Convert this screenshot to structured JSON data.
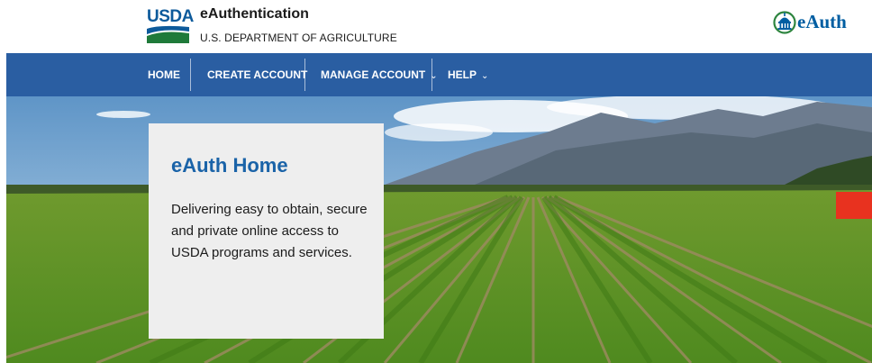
{
  "header": {
    "logo_text": "USDA",
    "title": "eAuthentication",
    "subtitle": "U.S. DEPARTMENT OF AGRICULTURE",
    "brand_text": "eAuth"
  },
  "nav": {
    "items": [
      {
        "label": "HOME"
      },
      {
        "label": "CREATE ACCOUNT"
      },
      {
        "label": "MANAGE ACCOUNT"
      },
      {
        "label": "HELP"
      }
    ]
  },
  "hero": {
    "title": "eAuth Home",
    "description": "Delivering easy to obtain, secure and private online access to USDA programs and services."
  },
  "colors": {
    "nav_bg": "#2a5ea2",
    "brand_blue": "#005ea2",
    "title_blue": "#1a63a8",
    "card_bg": "#eeeeee",
    "alert_red": "#e8321f"
  }
}
